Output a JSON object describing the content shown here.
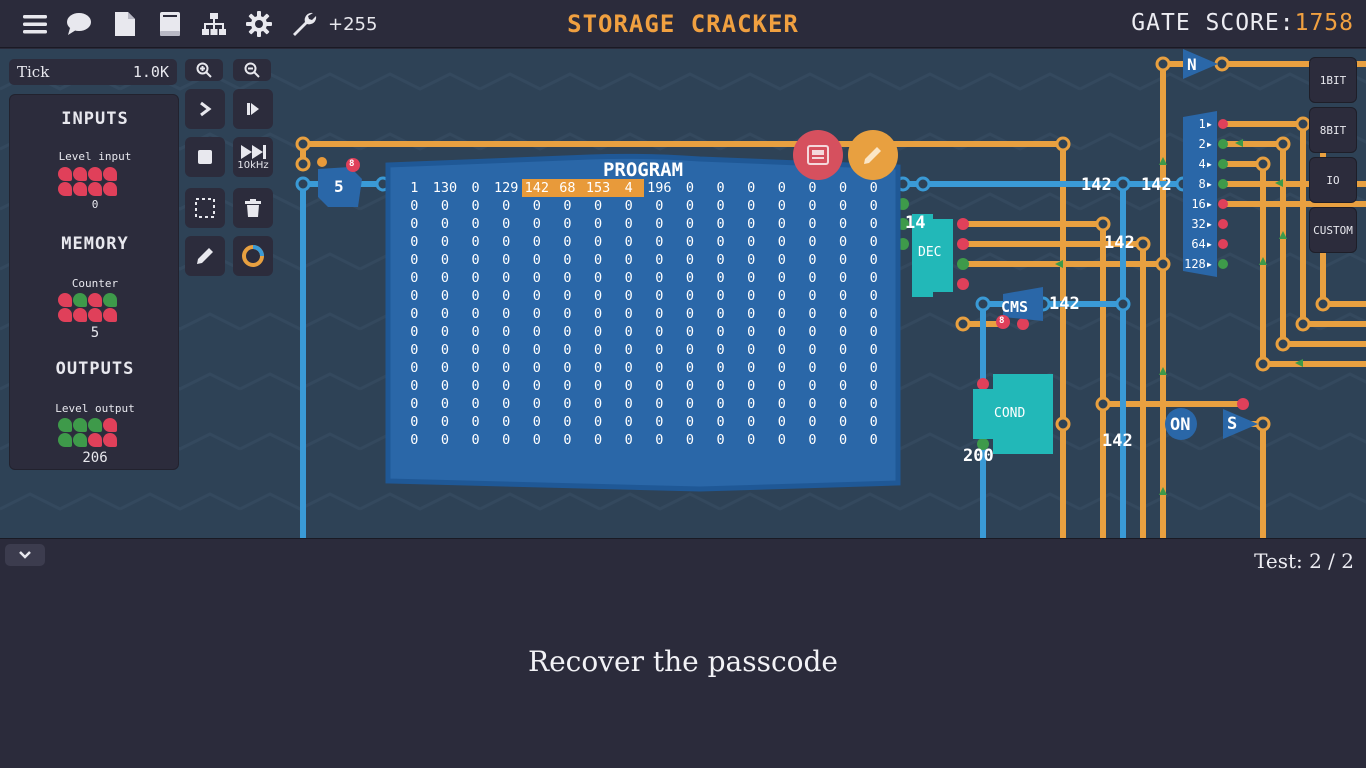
{
  "header": {
    "title": "STORAGE CRACKER",
    "bonus": "+255",
    "score_label": "GATE SCORE:",
    "score_value": "1758",
    "icons": [
      "menu-icon",
      "chat-icon",
      "document-icon",
      "book-icon",
      "hierarchy-icon",
      "gear-icon",
      "wrench-icon"
    ]
  },
  "tick": {
    "label": "Tick",
    "value": "1.0K"
  },
  "left_panel": {
    "inputs": {
      "heading": "INPUTS",
      "component": "Level input",
      "value": "0",
      "bits": [
        "r",
        "r",
        "r",
        "r",
        "r",
        "r",
        "r",
        "r"
      ]
    },
    "memory": {
      "heading": "MEMORY",
      "component": "Counter",
      "value": "5",
      "bits": [
        "r",
        "g",
        "r",
        "g",
        "r",
        "r",
        "r",
        "r"
      ]
    },
    "outputs": {
      "heading": "OUTPUTS",
      "component": "Level output",
      "value": "206",
      "bits": [
        "g",
        "g",
        "g",
        "r",
        "g",
        "g",
        "r",
        "r"
      ]
    }
  },
  "toolbar": {
    "speed_label": "10kHz"
  },
  "side_buttons": [
    "1BIT",
    "8BIT",
    "IO",
    "CUSTOM"
  ],
  "program": {
    "title": "PROGRAM",
    "first_row": [
      "1",
      "130",
      "0",
      "129",
      "142",
      "68",
      "153",
      "4",
      "196",
      "0",
      "0",
      "0",
      "0",
      "0",
      "0",
      "0"
    ],
    "highlight": [
      4,
      5,
      6,
      7
    ],
    "rows": 15,
    "cols": 16,
    "fill": "0"
  },
  "board_labels": {
    "counter_value": "5",
    "badge_top": "8",
    "badge_mid": "8",
    "dec": "DEC",
    "dec_in": "14",
    "cms": "CMS",
    "cond": "COND",
    "cond_in": "200",
    "wire_142_a": "142",
    "wire_142_b": "142",
    "wire_142_c": "142",
    "wire_142_d": "142",
    "wire_142_e": "142",
    "on": "ON",
    "s": "S",
    "n": "N",
    "splitter_bits": [
      "1",
      "2",
      "4",
      "8",
      "16",
      "32",
      "64",
      "128"
    ]
  },
  "colors": {
    "accent": "#f0a040",
    "board": "#2e4256",
    "wire_orange": "#e8a040",
    "wire_blue": "#3a9ad6",
    "bit_red": "#e0405a",
    "bit_green": "#3e9a4a"
  },
  "bottom": {
    "test_counter": "Test: 2 / 2",
    "goal": "Recover the passcode"
  }
}
